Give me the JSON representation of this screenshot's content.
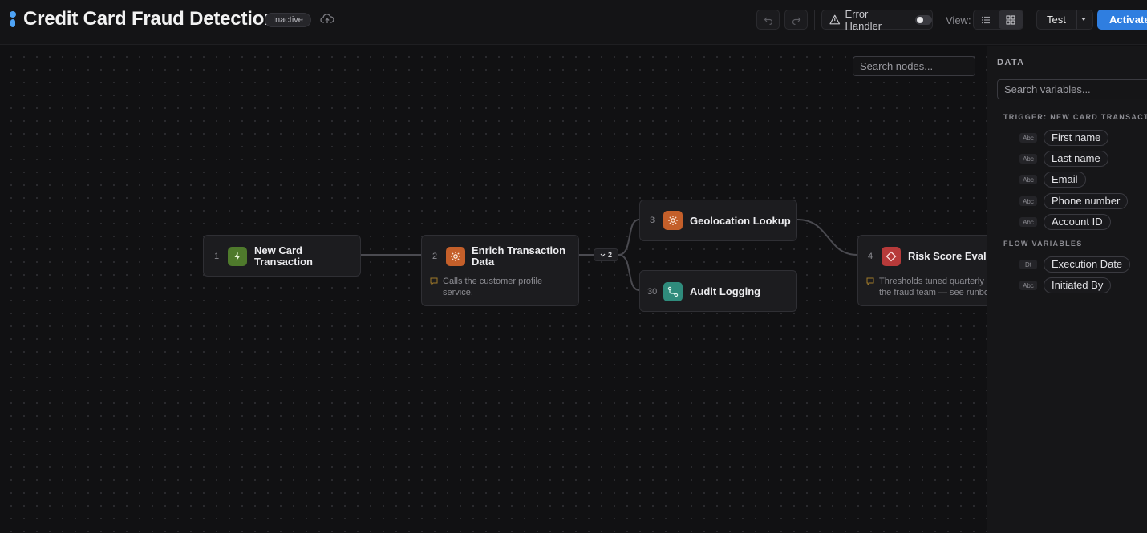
{
  "header": {
    "title": "Credit Card Fraud Detection",
    "status": "Inactive",
    "error_handler_label": "Error Handler",
    "error_handler_enabled": false,
    "view_label": "View:",
    "view_mode": "grid",
    "test_label": "Test",
    "activate_label": "Activate"
  },
  "canvas": {
    "search_placeholder": "Search nodes...",
    "nodes": [
      {
        "num": "1",
        "label_line1": "New Card",
        "label_line2": "Transaction",
        "icon": "bolt-icon",
        "color": "#4f7a2c"
      },
      {
        "num": "2",
        "label_line1": "Enrich Transaction",
        "label_line2": "Data",
        "icon": "gear-icon",
        "color": "#c45f2a",
        "note_line1": "Calls the customer profile",
        "note_line2": "service."
      },
      {
        "num": "3",
        "label_line1": "Geolocation Lookup",
        "icon": "gear-icon",
        "color": "#c45f2a"
      },
      {
        "num": "30",
        "label_line1": "Audit Logging",
        "icon": "route-icon",
        "color": "#2f8b7c"
      },
      {
        "num": "4",
        "label_line1": "Risk Score Evaluation",
        "icon": "diamond-icon",
        "color": "#b73a3a",
        "note_line1": "Thresholds tuned quarterly by",
        "note_line2": "the fraud team — see runbook."
      }
    ],
    "merge_badge": "2"
  },
  "panel": {
    "title": "DATA",
    "search_placeholder": "Search variables...",
    "trigger_section": "TRIGGER: NEW CARD TRANSACTION",
    "trigger_vars": [
      {
        "type": "Abc",
        "name": "First name"
      },
      {
        "type": "Abc",
        "name": "Last name"
      },
      {
        "type": "Abc",
        "name": "Email"
      },
      {
        "type": "Abc",
        "name": "Phone number"
      },
      {
        "type": "Abc",
        "name": "Account ID"
      }
    ],
    "flow_section": "FLOW VARIABLES",
    "flow_vars": [
      {
        "type": "Dt",
        "name": "Execution Date"
      },
      {
        "type": "Abc",
        "name": "Initiated By"
      }
    ]
  },
  "colors": {
    "accent": "#2f7ee0",
    "trigger": "#4f7a2c",
    "action": "#c45f2a",
    "logging": "#2f8b7c",
    "condition": "#b73a3a"
  }
}
